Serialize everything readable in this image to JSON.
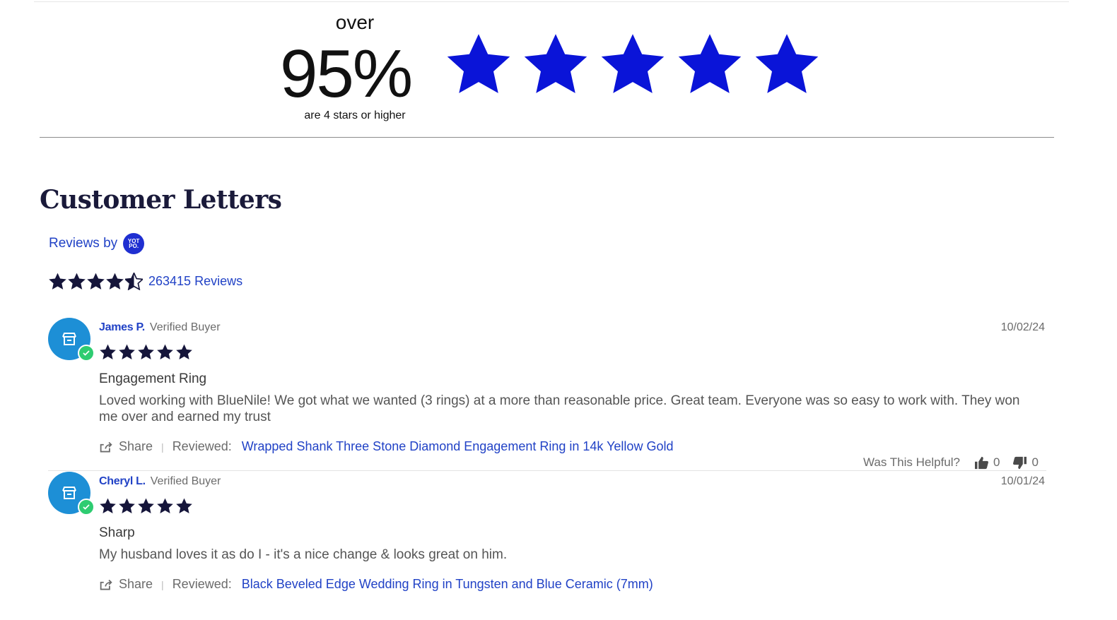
{
  "summary_banner": {
    "over": "over",
    "percent": "95%",
    "caption": "are 4 stars or higher",
    "star_color": "#0a14d8",
    "stars_shown": 5
  },
  "section": {
    "heading": "Customer Letters",
    "reviews_by": "Reviews by",
    "provider_logo": "YOT PO.",
    "average_rating": 4.5,
    "review_count": "263415 Reviews",
    "star_color": "#15153a"
  },
  "reviews": [
    {
      "name": "James P.",
      "badge": "Verified Buyer",
      "date": "10/02/24",
      "rating": 5,
      "title": "Engagement Ring",
      "body": "Loved working with BlueNile! We got what we wanted (3 rings) at a more than reasonable price. Great team. Everyone was so easy to work with. They won me over and earned my trust",
      "share": "Share",
      "reviewed_label": "Reviewed:",
      "product": "Wrapped Shank Three Stone Diamond Engagement Ring in 14k Yellow Gold",
      "helpful_label": "Was This Helpful?",
      "upvotes": "0",
      "downvotes": "0"
    },
    {
      "name": "Cheryl L.",
      "badge": "Verified Buyer",
      "date": "10/01/24",
      "rating": 5,
      "title": "Sharp",
      "body": "My husband loves it as do I - it's a nice change & looks great on him.",
      "share": "Share",
      "reviewed_label": "Reviewed:",
      "product": "Black Beveled Edge Wedding Ring in Tungsten and Blue Ceramic (7mm)"
    }
  ],
  "icons": {
    "avatar": "store-icon",
    "verified": "check-icon",
    "share": "share-icon",
    "upvote": "thumbs-up-icon",
    "downvote": "thumbs-down-icon",
    "avatar_color": "#1d8fd6",
    "verified_color": "#2ecc71",
    "link_color": "#2142c6"
  }
}
